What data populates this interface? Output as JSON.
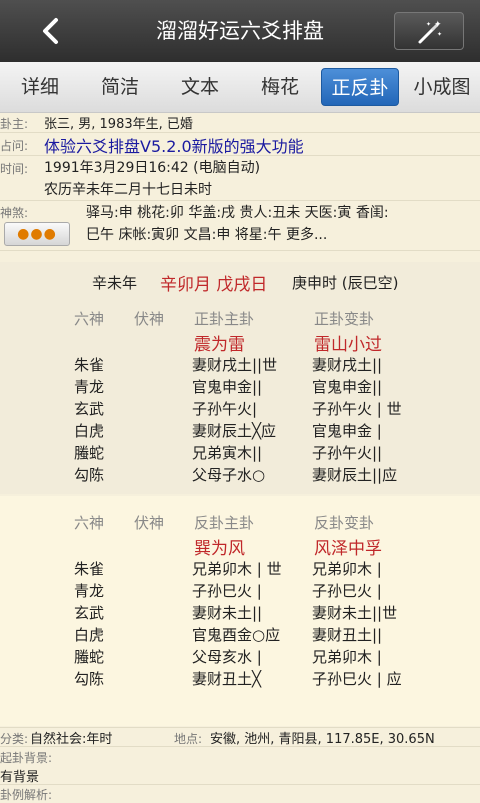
{
  "header": {
    "back_icon": "chevron-left-icon",
    "title": "溜溜好运六爻排盘",
    "tool_icon": "magic-wand-icon"
  },
  "tabs": [
    {
      "label": "详细",
      "active": false
    },
    {
      "label": "简洁",
      "active": false
    },
    {
      "label": "文本",
      "active": false
    },
    {
      "label": "梅花",
      "active": false
    },
    {
      "label": "正反卦",
      "active": true
    },
    {
      "label": "小成图",
      "active": false
    }
  ],
  "info": {
    "guazhu_label": "卦主:",
    "guazhu": "张三, 男, 1983年生, 已婚",
    "zhanwen_label": "占问:",
    "zhanwen": "体验六爻排盘V5.2.0新版的强大功能",
    "time_label": "时间:",
    "time": "1991年3月29日16:42 (电脑自动)",
    "lunar": "农历辛未年二月十七日未时",
    "shensha_label": "神煞:",
    "shensha_line1": "驿马:申  桃花:卯  华盖:戌  贵人:丑未  天医:寅  香闺:",
    "shensha_line2": "巳午  床帐:寅卯  文昌:申  将星:午  更多...",
    "shensha_button": "●●●"
  },
  "ganzhi": {
    "year": "辛未年",
    "month_day": "辛卯月 戊戌日",
    "hour": "庚申时 (辰巳空)"
  },
  "zheng": {
    "headers": [
      "六神",
      "伏神",
      "正卦主卦",
      "正卦变卦"
    ],
    "main_name": "震为雷",
    "change_name": "雷山小过",
    "rows": [
      {
        "shen": "朱雀",
        "main": "妻财戌土||世",
        "change": "妻财戌土||"
      },
      {
        "shen": "青龙",
        "main": "官鬼申金||",
        "change": "官鬼申金||"
      },
      {
        "shen": "玄武",
        "main": "子孙午火|",
        "change": "子孙午火 | 世"
      },
      {
        "shen": "白虎",
        "main": "妻财辰土╳应",
        "change": "官鬼申金 |"
      },
      {
        "shen": "螣蛇",
        "main": "兄弟寅木||",
        "change": "子孙午火||"
      },
      {
        "shen": "勾陈",
        "main": "父母子水○",
        "change": "妻财辰土||应"
      }
    ]
  },
  "fan": {
    "headers": [
      "六神",
      "伏神",
      "反卦主卦",
      "反卦变卦"
    ],
    "main_name": "巽为风",
    "change_name": "风泽中孚",
    "rows": [
      {
        "shen": "朱雀",
        "main": "兄弟卯木 | 世",
        "change": "兄弟卯木 |"
      },
      {
        "shen": "青龙",
        "main": "子孙巳火 |",
        "change": "子孙巳火 |"
      },
      {
        "shen": "玄武",
        "main": "妻财未土||",
        "change": "妻财未土||世"
      },
      {
        "shen": "白虎",
        "main": "官鬼酉金○应",
        "change": "妻财丑土||"
      },
      {
        "shen": "螣蛇",
        "main": "父母亥水 |",
        "change": "兄弟卯木 |"
      },
      {
        "shen": "勾陈",
        "main": "妻财丑土╳",
        "change": "子孙巳火 | 应"
      }
    ]
  },
  "footer": {
    "fenlei_label": "分类:",
    "fenlei": "自然社会:年时",
    "didian_label": "地点:",
    "didian": "安徽, 池州, 青阳县, 117.85E, 30.65N",
    "beijing_label": "起卦背景:",
    "beijing": "有背景",
    "jiexi_label": "卦例解析:"
  },
  "colors": {
    "accent": "#2266b8",
    "red_text": "#c0282a",
    "blue_text": "#1a1aa0",
    "bg": "#f6f0dc"
  }
}
